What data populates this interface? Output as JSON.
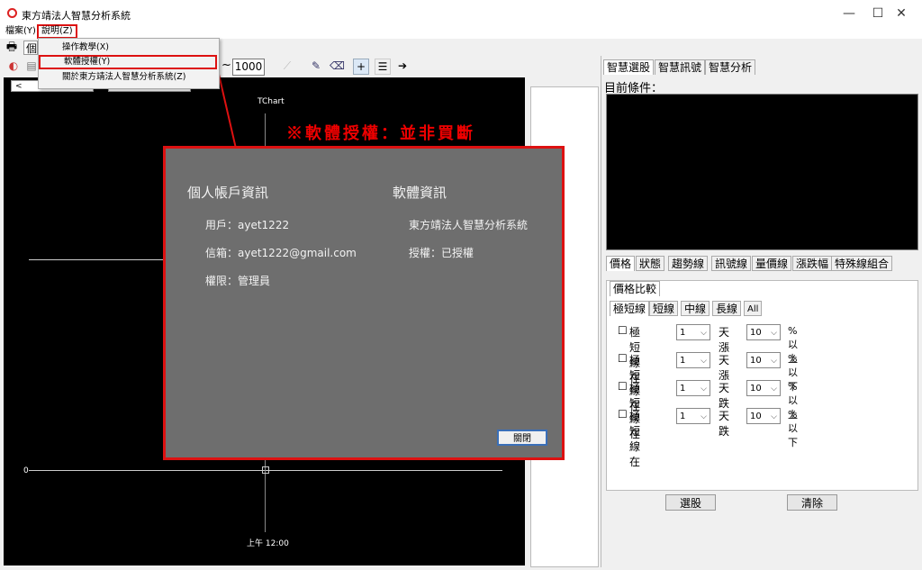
{
  "window": {
    "title": "東方靖法人智慧分析系統",
    "controls": {
      "minimize": "—",
      "maximize": "☐",
      "close": "✕"
    }
  },
  "menubar": {
    "items": [
      "檔案(Y)",
      "說明(Z)"
    ]
  },
  "dropdown": {
    "items": [
      "操作教學(X)",
      "軟體授權(Y)",
      "關於東方靖法人智慧分析系統(Z)"
    ]
  },
  "toolbar": {
    "first_tab_label": "個",
    "zoom_value": "1000",
    "tilde": "~"
  },
  "chart": {
    "title": "TChart",
    "zero_label": "0",
    "time_label": "上午 12:00",
    "scroll_left": "<",
    "scroll_right": ">"
  },
  "license_note": "※軟體授權：並非買斷",
  "dialog": {
    "account_heading": "個人帳戶資訊",
    "user": "用戶：ayet1222",
    "email": "信箱：ayet1222@gmail.com",
    "role": "權限：管理員",
    "software_heading": "軟體資訊",
    "software_name": "東方靖法人智慧分析系統",
    "license_status": "授權：已授權",
    "close_label": "關閉"
  },
  "right_panel": {
    "top_tabs": [
      "智慧選股",
      "智慧訊號",
      "智慧分析"
    ],
    "condition_label": "目前條件：",
    "filter_tabs": [
      "價格",
      "狀態",
      "趨勢線",
      "訊號線",
      "量價線",
      "漲跌幅",
      "特殊線組合"
    ],
    "sub_tab": "價格比較",
    "period_tabs": [
      "極短線",
      "短線",
      "中線",
      "長線",
      "All"
    ],
    "rows": [
      {
        "label": "極短線在",
        "days": "1",
        "unit": "天漲",
        "pct": "10",
        "suffix": "%以上"
      },
      {
        "label": "極短線在",
        "days": "1",
        "unit": "天漲",
        "pct": "10",
        "suffix": "%以下"
      },
      {
        "label": "極短線在",
        "days": "1",
        "unit": "天跌",
        "pct": "10",
        "suffix": "%以上"
      },
      {
        "label": "極短線在",
        "days": "1",
        "unit": "天跌",
        "pct": "10",
        "suffix": "%以下"
      }
    ],
    "select_button": "選股",
    "clear_button": "清除"
  }
}
